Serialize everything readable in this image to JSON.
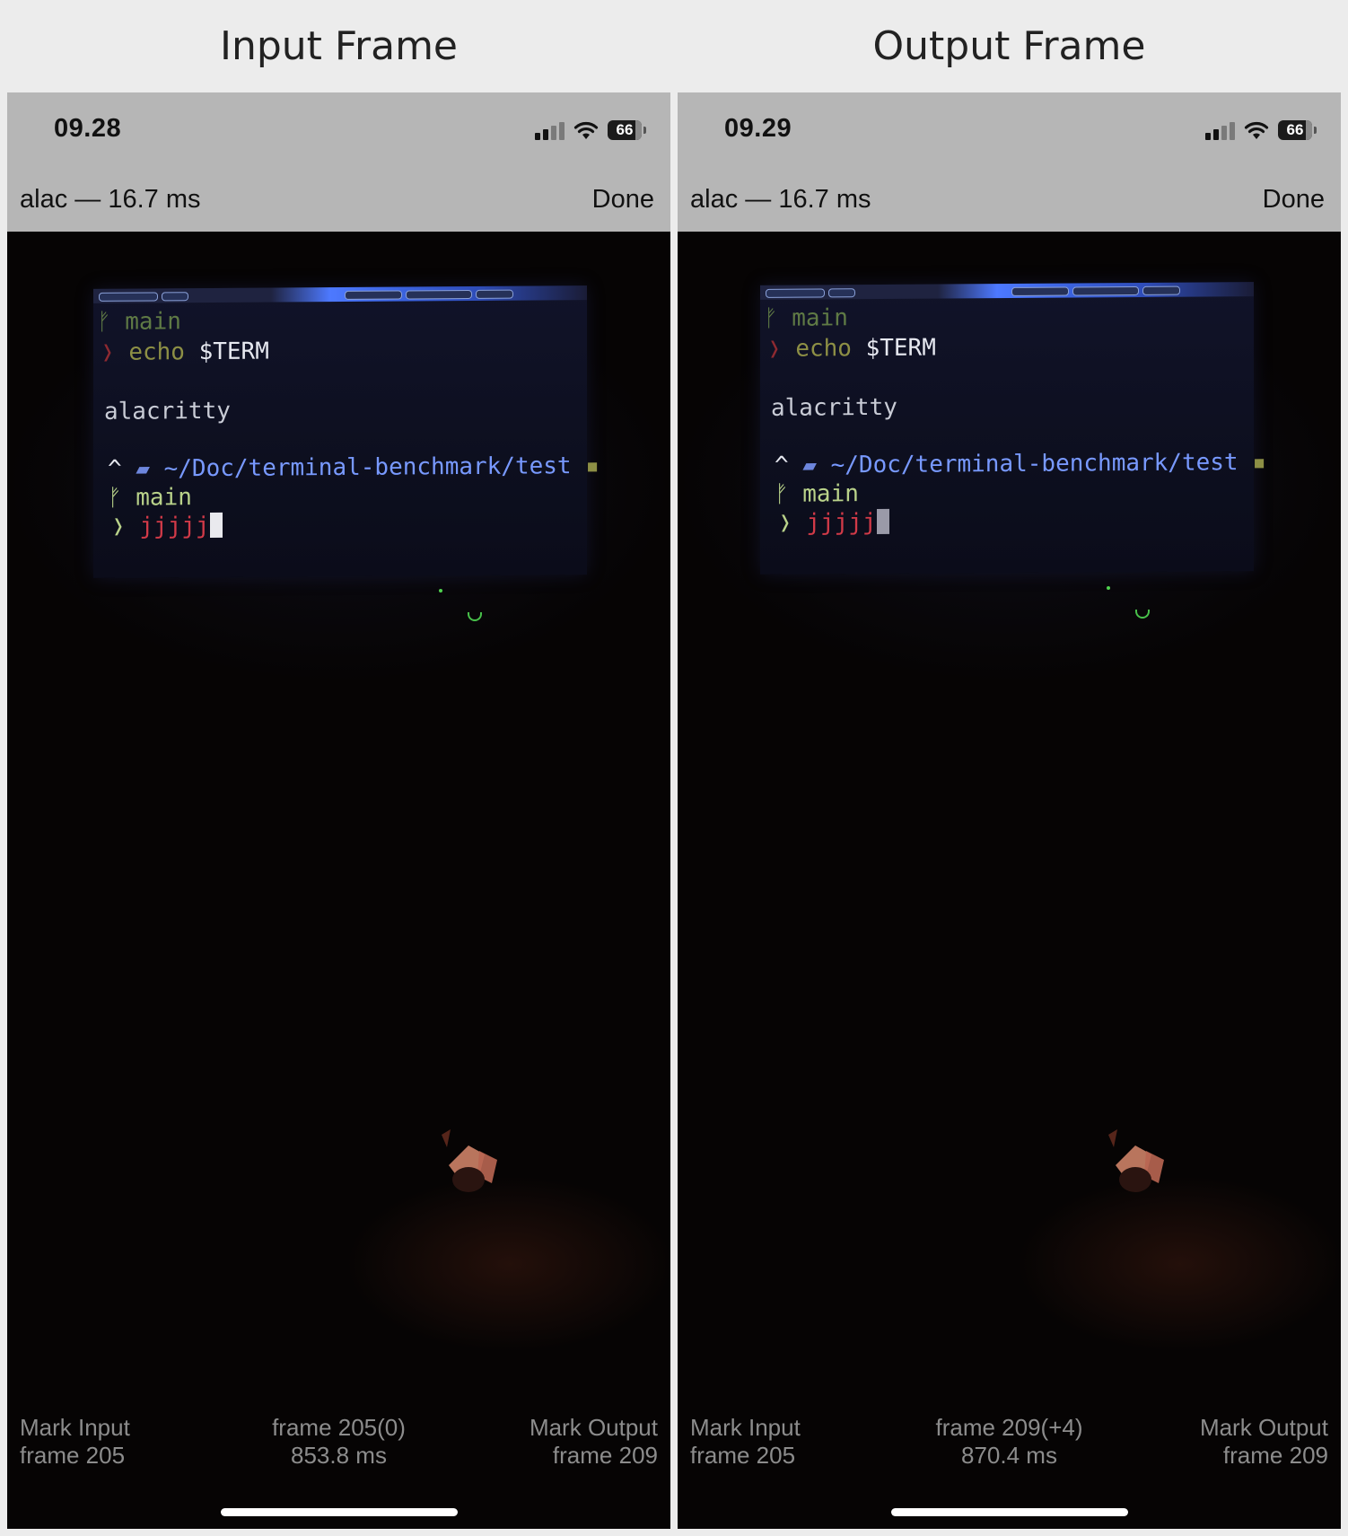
{
  "panels": [
    {
      "title": "Input Frame",
      "status_time": "09.28",
      "battery": "66",
      "nav_title": "alac — 16.7 ms",
      "done_label": "Done",
      "terminal": {
        "branch_line": "main",
        "command": "echo",
        "command_arg": "$TERM",
        "output": "alacritty",
        "path": "~/Doc/terminal-benchmark/test",
        "branch_line_2": "main",
        "typed_text": "jjjjj"
      },
      "mark_input_label": "Mark Input",
      "mark_input_frame": "frame 205",
      "current_frame": "frame 205(0)",
      "current_time": "853.8 ms",
      "mark_output_label": "Mark Output",
      "mark_output_frame": "frame 209"
    },
    {
      "title": "Output Frame",
      "status_time": "09.29",
      "battery": "66",
      "nav_title": "alac — 16.7 ms",
      "done_label": "Done",
      "terminal": {
        "branch_line": "main",
        "command": "echo",
        "command_arg": "$TERM",
        "output": "alacritty",
        "path": "~/Doc/terminal-benchmark/test",
        "branch_line_2": "main",
        "typed_text": "jjjjj"
      },
      "mark_input_label": "Mark Input",
      "mark_input_frame": "frame 205",
      "current_frame": "frame 209(+4)",
      "current_time": "870.4 ms",
      "mark_output_label": "Mark Output",
      "mark_output_frame": "frame 209"
    }
  ]
}
